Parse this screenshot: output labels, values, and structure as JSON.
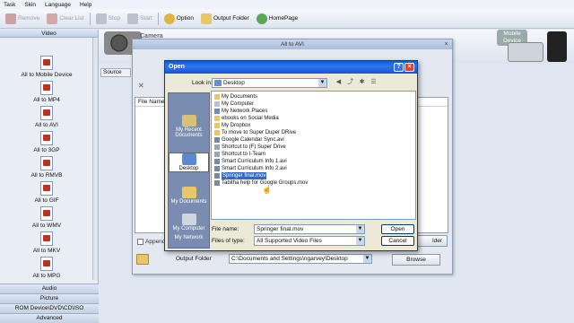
{
  "menu": [
    "Task",
    "Skin",
    "Language",
    "Help"
  ],
  "toolbar": {
    "remove": "Remove",
    "clear_list": "Clear List",
    "stop": "Stop",
    "start": "Start",
    "option": "Option",
    "output_folder": "Output Folder",
    "homepage": "HomePage"
  },
  "left_panel": {
    "header": "Video",
    "items": [
      "All to Mobile Device",
      "All to MP4",
      "All to AVI",
      "All to 3GP",
      "All to RMVB",
      "All to GIF",
      "All to WMV",
      "All to MKV",
      "All to MPG"
    ],
    "tabs": [
      "Audio",
      "Picture",
      "ROM Device\\DVD\\CD\\ISO",
      "Advanced"
    ]
  },
  "banner": {
    "camera_text": "Camera",
    "mobile_badge": "Mobile Device"
  },
  "bg_window": {
    "title": "All to AVI",
    "source_tab": "Source",
    "filename_header": "File Name",
    "right_header": "ge",
    "append_label": "Append s",
    "folder_button": "lder",
    "output_folder_label": "Output Folder",
    "output_path": "C:\\Documents and Settings\\ngarvey\\Desktop",
    "browse": "Browse"
  },
  "dialog": {
    "title": "Open",
    "look_in_label": "Look in:",
    "look_in_value": "Desktop",
    "places": [
      "My Recent Documents",
      "Desktop",
      "My Documents",
      "My Computer",
      "My Network"
    ],
    "files": [
      "My Documents",
      "My Computer",
      "My Network Places",
      "ebooks on Social Media",
      "My Dropbox",
      "To move to Super Duper DRive",
      "Google Calendar Sync.avi",
      "Shortcut to (F) Super Drive",
      "Shortcut to I-Team",
      "Smart Curriculum Info 1.avi",
      "Smart Curriculum Info 2.avi",
      "Springer final.mov",
      "Tabitha help for Google Groups.mov"
    ],
    "selected_file": "Springer final.mov",
    "file_name_label": "File name:",
    "file_name_value": "Springer final.mov",
    "file_type_label": "Files of type:",
    "file_type_value": "All Supported Video Files",
    "open_button": "Open",
    "cancel_button": "Cancel"
  },
  "colors": {
    "title_bar": "#1955d6",
    "selection": "#316ac5",
    "folder": "#e8c76a"
  }
}
